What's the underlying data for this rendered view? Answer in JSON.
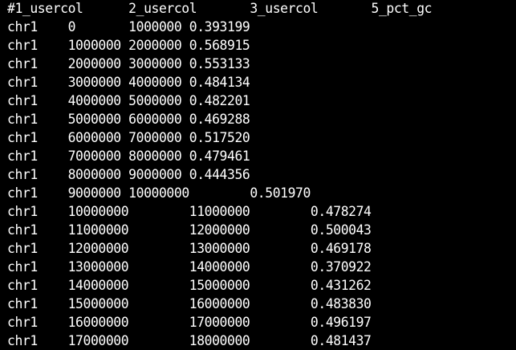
{
  "terminal": {
    "lines": [
      "#1_usercol\t2_usercol\t3_usercol\t5_pct_gc",
      "chr1\t0\t1000000 0.393199",
      "chr1\t1000000 2000000 0.568915",
      "chr1\t2000000 3000000 0.553133",
      "chr1\t3000000 4000000 0.484134",
      "chr1\t4000000 5000000 0.482201",
      "chr1\t5000000 6000000 0.469288",
      "chr1\t6000000 7000000 0.517520",
      "chr1\t7000000 8000000 0.479461",
      "chr1\t8000000 9000000 0.444356",
      "chr1\t9000000 10000000\t0.501970",
      "chr1\t10000000\t11000000\t0.478274",
      "chr1\t11000000\t12000000\t0.500043",
      "chr1\t12000000\t13000000\t0.469178",
      "chr1\t13000000\t14000000\t0.370922",
      "chr1\t14000000\t15000000\t0.431262",
      "chr1\t15000000\t16000000\t0.483830",
      "chr1\t16000000\t17000000\t0.496197",
      "chr1\t17000000\t18000000\t0.481437"
    ]
  }
}
